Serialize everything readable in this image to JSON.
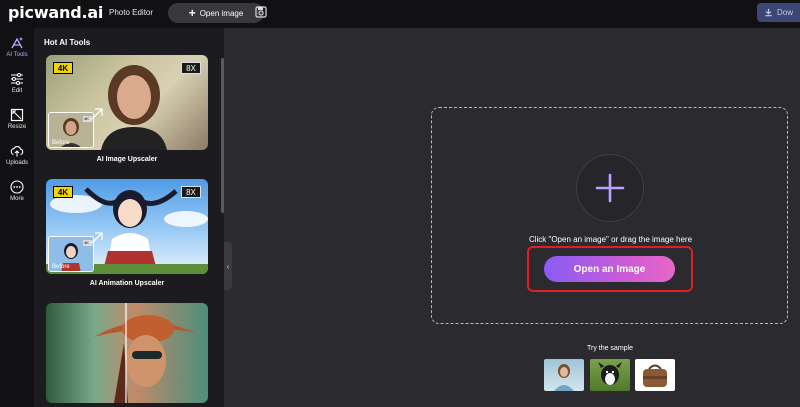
{
  "header": {
    "logo_main": "picwand",
    "logo_suffix": ".ai",
    "photo_editor": "Photo Editor",
    "open_image": "Open image",
    "download": "Dow"
  },
  "rail": {
    "items": [
      {
        "label": "AI Tools",
        "icon": "ai-tools-icon"
      },
      {
        "label": "Edit",
        "icon": "sliders-icon"
      },
      {
        "label": "Resize",
        "icon": "resize-icon"
      },
      {
        "label": "Uploads",
        "icon": "upload-cloud-icon"
      },
      {
        "label": "More",
        "icon": "more-icon"
      }
    ]
  },
  "panel": {
    "title": "Hot AI Tools",
    "cards": [
      {
        "caption": "AI Image Upscaler",
        "badge_left": "4K",
        "badge_right": "8X",
        "before": "Before",
        "mini": "4K"
      },
      {
        "caption": "AI Animation Upscaler",
        "badge_left": "4K",
        "badge_right": "8X",
        "before": "Before",
        "mini": "4K"
      },
      {
        "caption": ""
      }
    ]
  },
  "dropzone": {
    "instruction": "Click \"Open an image\" or drag the image here",
    "button": "Open an Image"
  },
  "samples": {
    "title": "Try the sample"
  },
  "colors": {
    "accent": "#8a5cf6",
    "highlight": "#e02020",
    "background": "#2b2b2f",
    "panel": "#1c1c20"
  }
}
